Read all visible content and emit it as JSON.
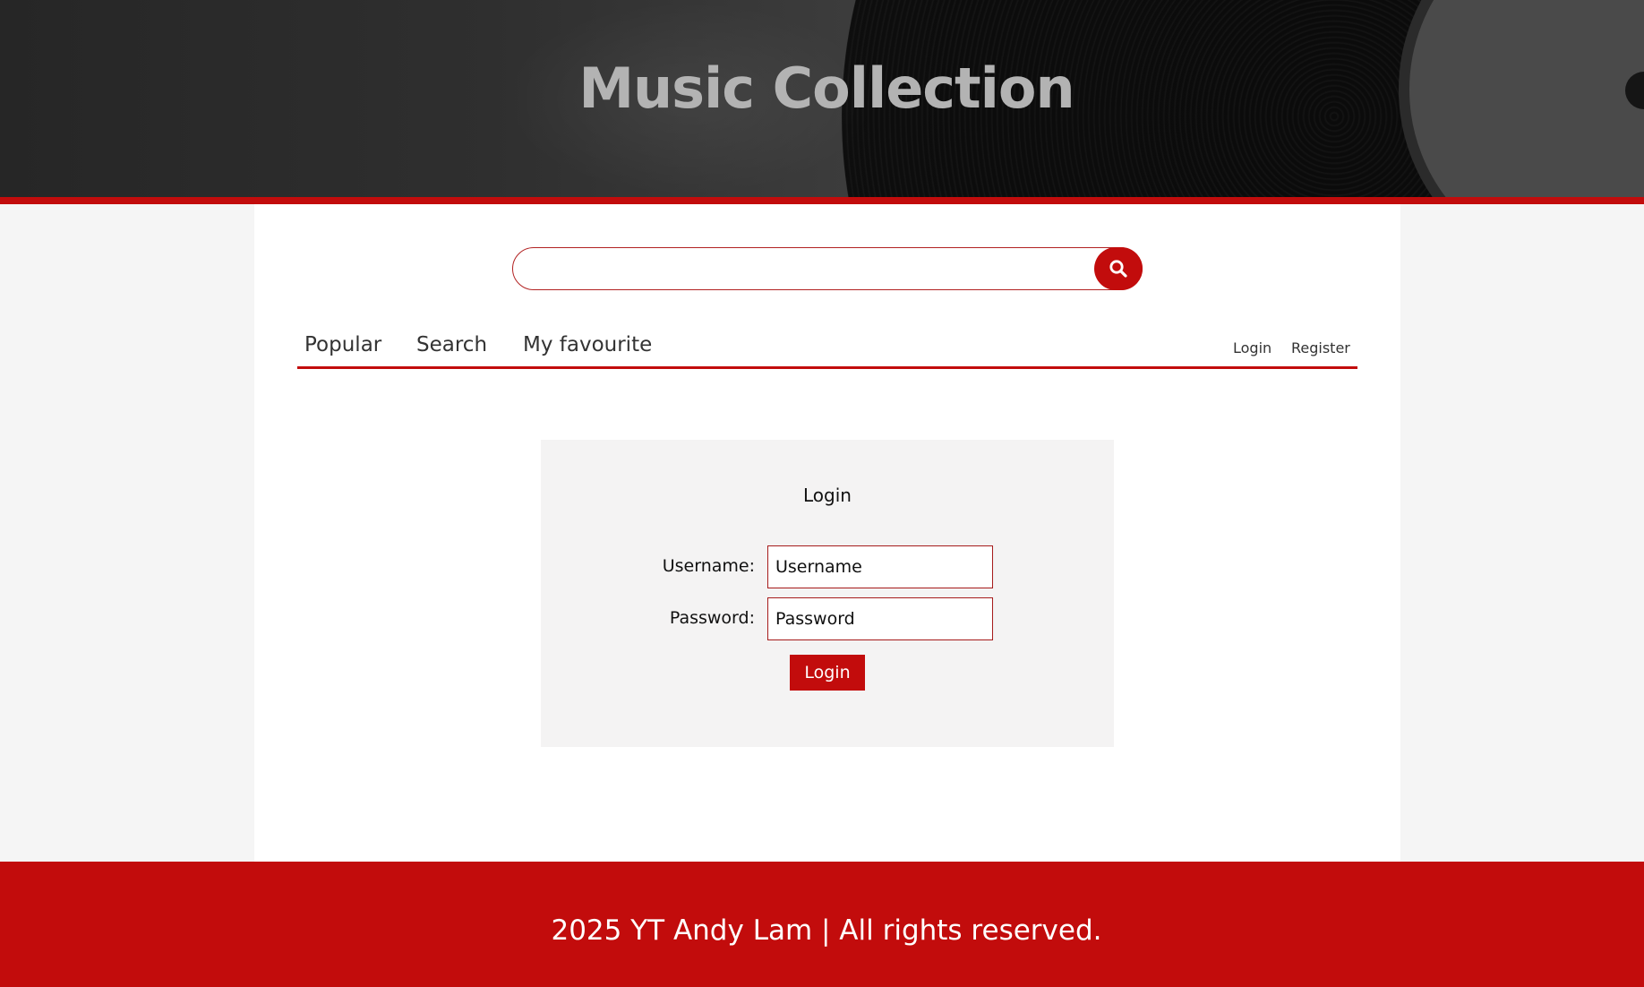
{
  "header": {
    "title": "Music Collection"
  },
  "search": {
    "value": "",
    "placeholder": "",
    "icon": "search-icon"
  },
  "nav": {
    "tabs": [
      {
        "label": "Popular"
      },
      {
        "label": "Search"
      },
      {
        "label": "My favourite"
      }
    ],
    "auth": [
      {
        "label": "Login"
      },
      {
        "label": "Register"
      }
    ]
  },
  "login_form": {
    "heading": "Login",
    "username_label": "Username:",
    "username_placeholder": "Username",
    "password_label": "Password:",
    "password_placeholder": "Password",
    "submit_label": "Login"
  },
  "footer": {
    "text": "2025 YT Andy Lam | All rights reserved."
  },
  "colors": {
    "accent": "#c20c0c",
    "header_text": "#b3b3b3",
    "card_background": "#f4f3f3"
  }
}
